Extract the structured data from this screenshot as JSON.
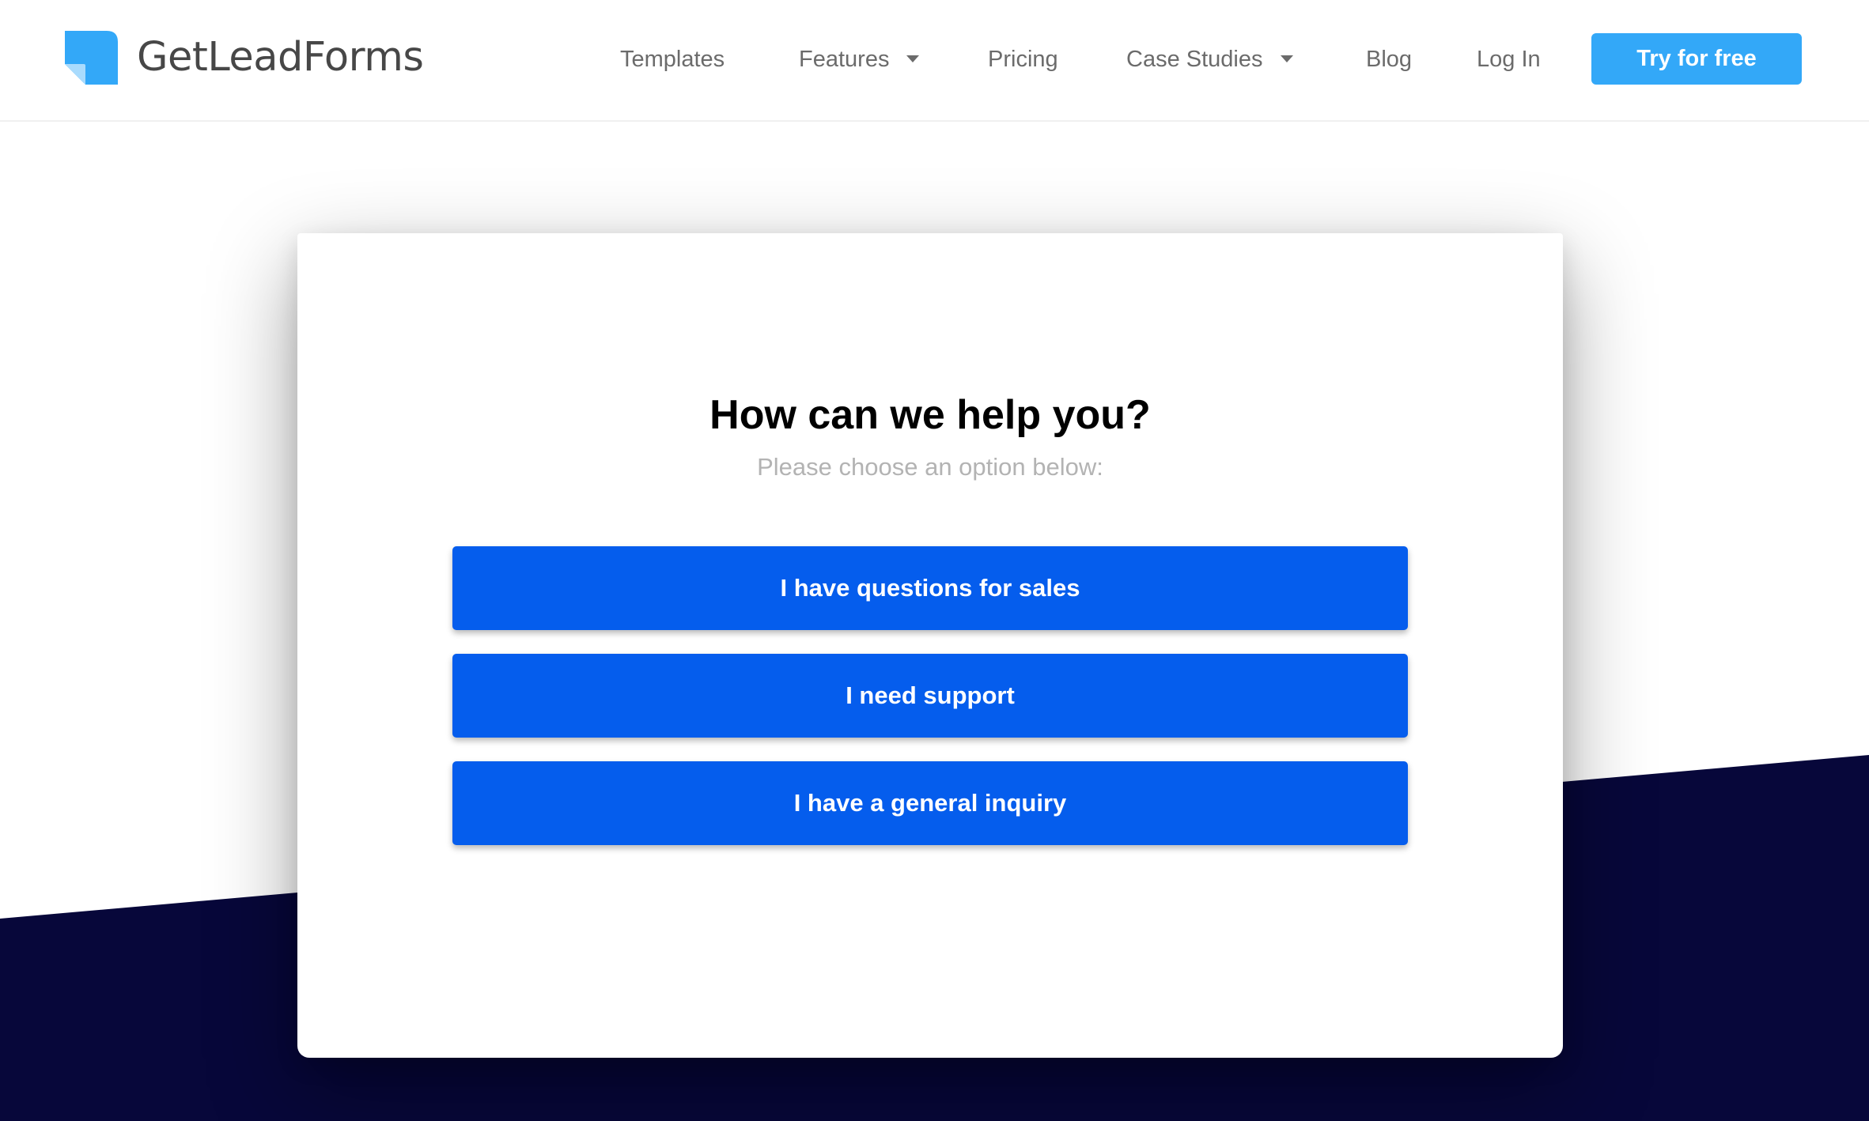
{
  "brand": {
    "name": "GetLeadForms",
    "logo_icon": "folded-page-icon",
    "colors": {
      "logo_primary": "#33a8f8",
      "logo_fold": "#a9dbfd",
      "logo_text": "#474747"
    }
  },
  "nav": {
    "items": [
      {
        "label": "Templates",
        "has_dropdown": false
      },
      {
        "label": "Features",
        "has_dropdown": true
      },
      {
        "label": "Pricing",
        "has_dropdown": false
      },
      {
        "label": "Case Studies",
        "has_dropdown": true
      },
      {
        "label": "Blog",
        "has_dropdown": false
      },
      {
        "label": "Log In",
        "has_dropdown": false
      }
    ],
    "cta_label": "Try for free",
    "colors": {
      "text": "#6b6b6b",
      "cta_bg": "#33a8f8",
      "cta_text": "#ffffff"
    }
  },
  "form": {
    "title": "How can we help you?",
    "subtitle": "Please choose an option below:",
    "options": [
      {
        "label": "I have questions for sales"
      },
      {
        "label": "I need support"
      },
      {
        "label": "I have a general inquiry"
      }
    ],
    "colors": {
      "option_bg": "#055ded",
      "option_text": "#ffffff",
      "title": "#000000",
      "subtitle": "#b3b3b3"
    }
  },
  "background": {
    "colors": {
      "top": "#ffffff",
      "bottom_band": "#07073a"
    }
  }
}
